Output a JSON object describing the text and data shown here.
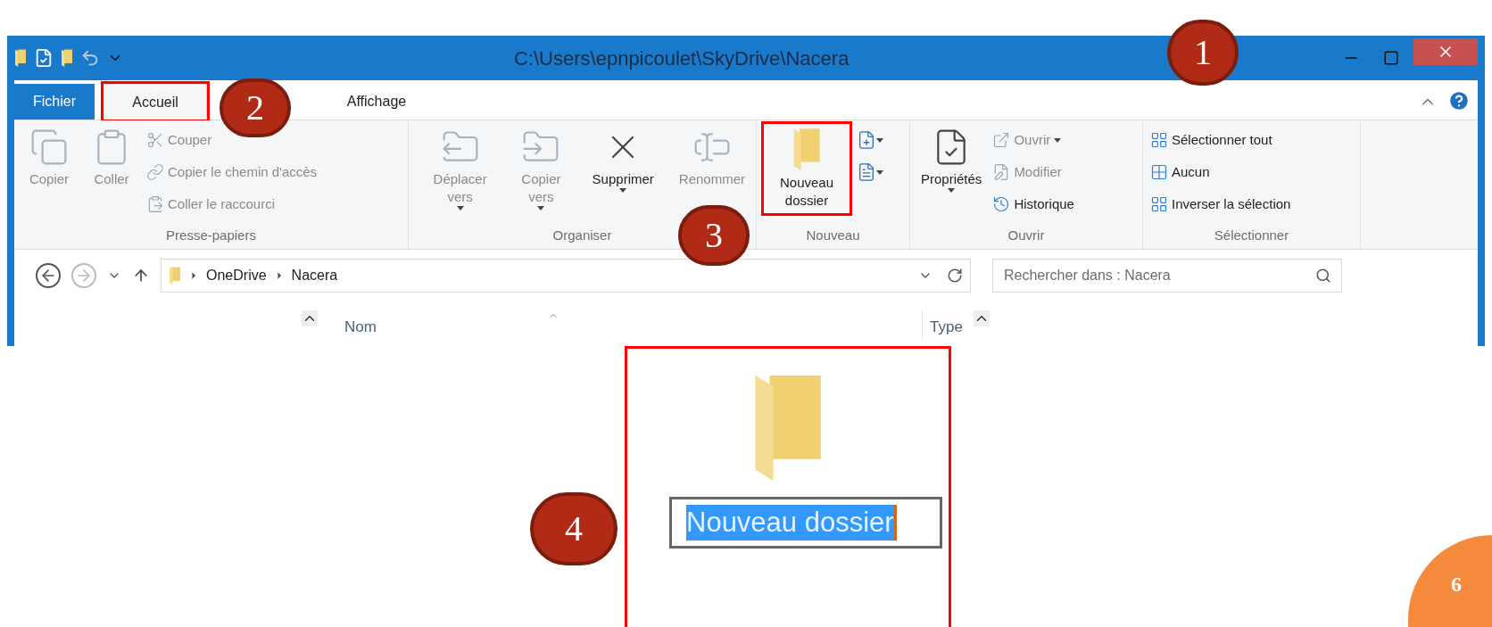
{
  "window": {
    "title": "C:\\Users\\epnpicoulet\\SkyDrive\\Nacera"
  },
  "ribbon_tabs": [
    {
      "label": "Fichier",
      "kind": "file",
      "selected": false,
      "highlighted": false
    },
    {
      "label": "Accueil",
      "kind": "tab",
      "selected": true,
      "highlighted": true
    },
    {
      "label": "Affichage",
      "kind": "tab",
      "selected": false,
      "highlighted": false
    }
  ],
  "ribbon_groups": [
    {
      "label": "Presse-papiers",
      "columns": [
        [
          {
            "kind": "large",
            "label": "Copier",
            "disabled": true,
            "dropdown": false,
            "highlighted": false
          }
        ],
        [
          {
            "kind": "large",
            "label": "Coller",
            "disabled": true,
            "dropdown": false,
            "highlighted": false
          }
        ],
        [
          {
            "kind": "small",
            "label": "Couper",
            "disabled": true,
            "dropdown": false
          },
          {
            "kind": "small",
            "label": "Copier le chemin d'accès",
            "disabled": true,
            "dropdown": false
          },
          {
            "kind": "small",
            "label": "Coller le raccourci",
            "disabled": true,
            "dropdown": false
          }
        ]
      ]
    },
    {
      "label": "Organiser",
      "columns": [
        [
          {
            "kind": "large",
            "label": "Déplacer vers",
            "disabled": true,
            "dropdown": true,
            "highlighted": false
          }
        ],
        [
          {
            "kind": "large",
            "label": "Copier vers",
            "disabled": true,
            "dropdown": true,
            "highlighted": false
          }
        ],
        [
          {
            "kind": "large",
            "label": "Supprimer",
            "disabled": false,
            "dropdown": true,
            "highlighted": false
          }
        ],
        [
          {
            "kind": "large",
            "label": "Renommer",
            "disabled": true,
            "dropdown": false,
            "highlighted": false
          }
        ]
      ]
    },
    {
      "label": "Nouveau",
      "columns": [
        [
          {
            "kind": "large",
            "label": "Nouveau dossier",
            "disabled": false,
            "dropdown": false,
            "highlighted": true
          }
        ],
        [
          {
            "kind": "icon",
            "disabled": false,
            "dropdown": true
          },
          {
            "kind": "icon",
            "disabled": false,
            "dropdown": true
          }
        ]
      ]
    },
    {
      "label": "Ouvrir",
      "columns": [
        [
          {
            "kind": "large",
            "label": "Propriétés",
            "disabled": false,
            "dropdown": true,
            "highlighted": false
          }
        ],
        [
          {
            "kind": "small",
            "label": "Ouvrir",
            "disabled": true,
            "dropdown": true
          },
          {
            "kind": "small",
            "label": "Modifier",
            "disabled": true,
            "dropdown": false
          },
          {
            "kind": "small",
            "label": "Historique",
            "disabled": false,
            "dropdown": false
          }
        ]
      ]
    },
    {
      "label": "Sélectionner",
      "columns": [
        [
          {
            "kind": "small",
            "label": "Sélectionner tout",
            "disabled": false,
            "dropdown": false
          },
          {
            "kind": "small",
            "label": "Aucun",
            "disabled": false,
            "dropdown": false
          },
          {
            "kind": "small",
            "label": "Inverser la sélection",
            "disabled": false,
            "dropdown": false
          }
        ]
      ]
    }
  ],
  "address_bar": {
    "breadcrumbs": [
      "OneDrive",
      "Nacera"
    ]
  },
  "search": {
    "placeholder": "Rechercher dans : Nacera"
  },
  "columns": [
    {
      "label": "Nom",
      "sorted": true
    },
    {
      "label": "Type",
      "sorted": false
    }
  ],
  "rename": {
    "value": "Nouveau dossier",
    "text_selected": true,
    "highlighted": true
  },
  "callouts": [
    {
      "label": "1",
      "kind": "dark"
    },
    {
      "label": "2",
      "kind": "dark"
    },
    {
      "label": "3",
      "kind": "dark"
    },
    {
      "label": "4",
      "kind": "dark"
    },
    {
      "label": "6",
      "kind": "orange"
    }
  ]
}
